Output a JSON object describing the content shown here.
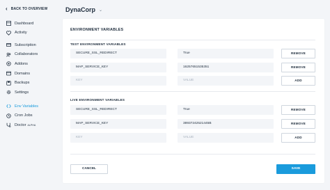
{
  "sidebar": {
    "back_label": "BACK TO OVERVIEW",
    "items": [
      {
        "label": "Dashboard",
        "icon": "dashboard-icon"
      },
      {
        "label": "Activity",
        "icon": "activity-icon"
      },
      {
        "label": "Subscription",
        "icon": "subscription-icon"
      },
      {
        "label": "Collaborators",
        "icon": "collaborators-icon"
      },
      {
        "label": "Addons",
        "icon": "addons-icon"
      },
      {
        "label": "Domains",
        "icon": "domains-icon"
      },
      {
        "label": "Backups",
        "icon": "backups-icon"
      },
      {
        "label": "Settings",
        "icon": "settings-icon"
      },
      {
        "label": "Env Variables",
        "icon": "env-variables-icon",
        "active": true
      },
      {
        "label": "Cron Jobs",
        "icon": "cron-jobs-icon"
      },
      {
        "label": "Doctor",
        "icon": "doctor-icon",
        "badge": "ALPHA"
      }
    ]
  },
  "header": {
    "title": "DynaCorp"
  },
  "main": {
    "section_title": "ENVIRONMENT VARIABLES",
    "test": {
      "title": "TEST ENVIRONMENT VARIABLES",
      "rows": [
        {
          "key": "SECURE_SSL_REDIRECT",
          "value": "True",
          "action": "REMOVE"
        },
        {
          "key": "MAP_SERVICE_KEY",
          "value": "16257651535351",
          "action": "REMOVE"
        }
      ],
      "new_row": {
        "key_placeholder": "KEY",
        "value_placeholder": "VALUE",
        "action": "ADD"
      }
    },
    "live": {
      "title": "LIVE ENVIRONMENT VARIABLES",
      "rows": [
        {
          "key": "SECURE_SSL_REDIRECT",
          "value": "True",
          "action": "REMOVE"
        },
        {
          "key": "MAP_SERVICE_KEY",
          "value": "38937242521445B",
          "action": "REMOVE"
        }
      ],
      "new_row": {
        "key_placeholder": "KEY",
        "value_placeholder": "VALUE",
        "action": "ADD"
      }
    },
    "cancel_label": "CANCEL",
    "save_label": "SAVE"
  },
  "colors": {
    "accent": "#1a9bdc",
    "background": "#f3f5f8",
    "card": "#ffffff"
  }
}
